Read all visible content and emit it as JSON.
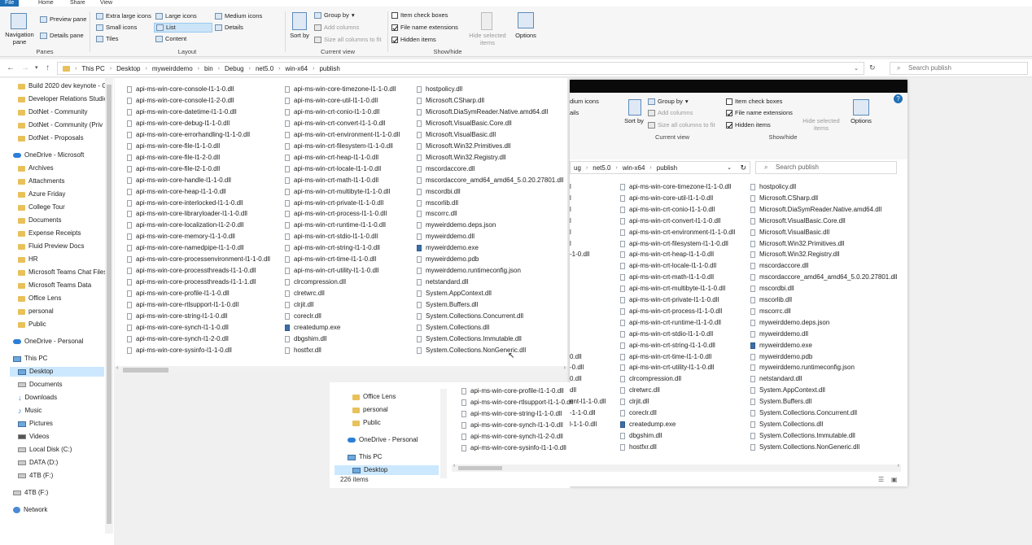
{
  "tabs": [
    "File",
    "Home",
    "Share",
    "View"
  ],
  "ribbon": {
    "panes": {
      "label": "Panes",
      "navigation_pane": "Navigation pane",
      "preview_pane": "Preview pane",
      "details_pane": "Details pane"
    },
    "layout": {
      "label": "Layout",
      "items": [
        "Extra large icons",
        "Large icons",
        "Medium icons",
        "Small icons",
        "List",
        "Details",
        "Tiles",
        "Content"
      ],
      "selected": "List"
    },
    "current_view": {
      "label": "Current view",
      "sort_by": "Sort by",
      "group_by": "Group by",
      "add_columns": "Add columns",
      "size_all_columns": "Size all columns to fit"
    },
    "show_hide": {
      "label": "Show/hide",
      "item_check_boxes": "Item check boxes",
      "file_name_extensions": "File name extensions",
      "hidden_items": "Hidden items",
      "hide_selected_items": "Hide selected items",
      "options": "Options"
    }
  },
  "address": {
    "crumbs": [
      "This PC",
      "Desktop",
      "myweirddemo",
      "bin",
      "Debug",
      "net5.0",
      "win-x64",
      "publish"
    ],
    "search_placeholder": "Search publish"
  },
  "nav": {
    "quick_items": [
      "Build 2020 dev keynote - G",
      "Developer Relations Studio",
      "DotNet - Community",
      "DotNet - Community (Priv",
      "DotNet - Proposals"
    ],
    "onedrive_ms": "OneDrive - Microsoft",
    "onedrive_items": [
      "Archives",
      "Attachments",
      "Azure Friday",
      "College Tour",
      "Documents",
      "Expense Receipts",
      "Fluid Preview Docs",
      "HR",
      "Microsoft Teams Chat Files",
      "Microsoft Teams Data",
      "Office Lens",
      "personal",
      "Public"
    ],
    "onedrive_personal": "OneDrive - Personal",
    "this_pc": "This PC",
    "pc_items": [
      "Desktop",
      "Documents",
      "Downloads",
      "Music",
      "Pictures",
      "Videos",
      "Local Disk (C:)",
      "DATA (D:)",
      "4TB (F:)"
    ],
    "drive_4tb": "4TB (F:)",
    "network": "Network"
  },
  "files": {
    "col1": [
      "api-ms-win-core-console-l1-1-0.dll",
      "api-ms-win-core-console-l1-2-0.dll",
      "api-ms-win-core-datetime-l1-1-0.dll",
      "api-ms-win-core-debug-l1-1-0.dll",
      "api-ms-win-core-errorhandling-l1-1-0.dll",
      "api-ms-win-core-file-l1-1-0.dll",
      "api-ms-win-core-file-l1-2-0.dll",
      "api-ms-win-core-file-l2-1-0.dll",
      "api-ms-win-core-handle-l1-1-0.dll",
      "api-ms-win-core-heap-l1-1-0.dll",
      "api-ms-win-core-interlocked-l1-1-0.dll",
      "api-ms-win-core-libraryloader-l1-1-0.dll",
      "api-ms-win-core-localization-l1-2-0.dll",
      "api-ms-win-core-memory-l1-1-0.dll",
      "api-ms-win-core-namedpipe-l1-1-0.dll",
      "api-ms-win-core-processenvironment-l1-1-0.dll",
      "api-ms-win-core-processthreads-l1-1-0.dll",
      "api-ms-win-core-processthreads-l1-1-1.dll",
      "api-ms-win-core-profile-l1-1-0.dll",
      "api-ms-win-core-rtlsupport-l1-1-0.dll",
      "api-ms-win-core-string-l1-1-0.dll",
      "api-ms-win-core-synch-l1-1-0.dll",
      "api-ms-win-core-synch-l1-2-0.dll",
      "api-ms-win-core-sysinfo-l1-1-0.dll"
    ],
    "col2": [
      "api-ms-win-core-timezone-l1-1-0.dll",
      "api-ms-win-core-util-l1-1-0.dll",
      "api-ms-win-crt-conio-l1-1-0.dll",
      "api-ms-win-crt-convert-l1-1-0.dll",
      "api-ms-win-crt-environment-l1-1-0.dll",
      "api-ms-win-crt-filesystem-l1-1-0.dll",
      "api-ms-win-crt-heap-l1-1-0.dll",
      "api-ms-win-crt-locale-l1-1-0.dll",
      "api-ms-win-crt-math-l1-1-0.dll",
      "api-ms-win-crt-multibyte-l1-1-0.dll",
      "api-ms-win-crt-private-l1-1-0.dll",
      "api-ms-win-crt-process-l1-1-0.dll",
      "api-ms-win-crt-runtime-l1-1-0.dll",
      "api-ms-win-crt-stdio-l1-1-0.dll",
      "api-ms-win-crt-string-l1-1-0.dll",
      "api-ms-win-crt-time-l1-1-0.dll",
      "api-ms-win-crt-utility-l1-1-0.dll",
      "clrcompression.dll",
      "clretwrc.dll",
      "clrjit.dll",
      "coreclr.dll",
      "createdump.exe",
      "dbgshim.dll",
      "hostfxr.dll"
    ],
    "col3": [
      "hostpolicy.dll",
      "Microsoft.CSharp.dll",
      "Microsoft.DiaSymReader.Native.amd64.dll",
      "Microsoft.VisualBasic.Core.dll",
      "Microsoft.VisualBasic.dll",
      "Microsoft.Win32.Primitives.dll",
      "Microsoft.Win32.Registry.dll",
      "mscordaccore.dll",
      "mscordaccore_amd64_amd64_5.0.20.27801.dll",
      "mscordbi.dll",
      "mscorlib.dll",
      "mscorrc.dll",
      "myweirddemo.deps.json",
      "myweirddemo.dll",
      "myweirddemo.exe",
      "myweirddemo.pdb",
      "myweirddemo.runtimeconfig.json",
      "netstandard.dll",
      "System.AppContext.dll",
      "System.Buffers.dll",
      "System.Collections.Concurrent.dll",
      "System.Collections.dll",
      "System.Collections.Immutable.dll",
      "System.Collections.NonGeneric.dll"
    ]
  },
  "back_window": {
    "ribbon": {
      "medium_icons": "dium icons",
      "details": "ails",
      "sort_by": "Sort by",
      "group_by": "Group by",
      "add_columns": "Add columns",
      "size_all_columns": "Size all columns to fit",
      "current_view": "Current view",
      "item_check_boxes": "Item check boxes",
      "file_name_extensions": "File name extensions",
      "hidden_items": "Hidden items",
      "hide_selected_items": "Hide selected items",
      "options": "Options",
      "show_hide": "Show/hide"
    },
    "crumbs": [
      "ug",
      "net5.0",
      "win-x64",
      "publish"
    ],
    "search_placeholder": "Search publish",
    "left_fragments": [
      "l",
      "l",
      "l",
      "l",
      "l",
      "l",
      "-1-0.dll",
      "",
      "",
      "",
      "",
      "",
      "",
      "",
      "",
      "0.dll",
      "-0.dll",
      "0.dll",
      "dll",
      "ent-l1-1-0.dll",
      "-1-1-0.dll",
      "l-1-1-0.dll"
    ],
    "col2": [
      "api-ms-win-core-timezone-l1-1-0.dll",
      "api-ms-win-core-util-l1-1-0.dll",
      "api-ms-win-crt-conio-l1-1-0.dll",
      "api-ms-win-crt-convert-l1-1-0.dll",
      "api-ms-win-crt-environment-l1-1-0.dll",
      "api-ms-win-crt-filesystem-l1-1-0.dll",
      "api-ms-win-crt-heap-l1-1-0.dll",
      "api-ms-win-crt-locale-l1-1-0.dll",
      "api-ms-win-crt-math-l1-1-0.dll",
      "api-ms-win-crt-multibyte-l1-1-0.dll",
      "api-ms-win-crt-private-l1-1-0.dll",
      "api-ms-win-crt-process-l1-1-0.dll",
      "api-ms-win-crt-runtime-l1-1-0.dll",
      "api-ms-win-crt-stdio-l1-1-0.dll",
      "api-ms-win-crt-string-l1-1-0.dll",
      "api-ms-win-crt-time-l1-1-0.dll",
      "api-ms-win-crt-utility-l1-1-0.dll",
      "clrcompression.dll",
      "clretwrc.dll",
      "clrjit.dll",
      "coreclr.dll",
      "createdump.exe",
      "dbgshim.dll",
      "hostfxr.dll"
    ],
    "col3": [
      "hostpolicy.dll",
      "Microsoft.CSharp.dll",
      "Microsoft.DiaSymReader.Native.amd64.dll",
      "Microsoft.VisualBasic.Core.dll",
      "Microsoft.VisualBasic.dll",
      "Microsoft.Win32.Primitives.dll",
      "Microsoft.Win32.Registry.dll",
      "mscordaccore.dll",
      "mscordaccore_amd64_amd64_5.0.20.27801.dll",
      "mscordbi.dll",
      "mscorlib.dll",
      "mscorrc.dll",
      "myweirddemo.deps.json",
      "myweirddemo.dll",
      "myweirddemo.exe",
      "myweirddemo.pdb",
      "myweirddemo.runtimeconfig.json",
      "netstandard.dll",
      "System.AppContext.dll",
      "System.Buffers.dll",
      "System.Collections.Concurrent.dll",
      "System.Collections.dll",
      "System.Collections.Immutable.dll",
      "System.Collections.NonGeneric.dll"
    ],
    "lower_col1": [
      "api-ms-win-core-profile-l1-1-0.dll",
      "api-ms-win-core-rtlsupport-l1-1-0.dll",
      "api-ms-win-core-string-l1-1-0.dll",
      "api-ms-win-core-synch-l1-1-0.dll",
      "api-ms-win-core-synch-l1-2-0.dll",
      "api-ms-win-core-sysinfo-l1-1-0.dll"
    ],
    "lower_nav": [
      "Office Lens",
      "personal",
      "Public"
    ],
    "lower_onedrive": "OneDrive - Personal",
    "lower_this_pc": "This PC",
    "lower_desktop": "Desktop",
    "item_count": "226 items"
  }
}
